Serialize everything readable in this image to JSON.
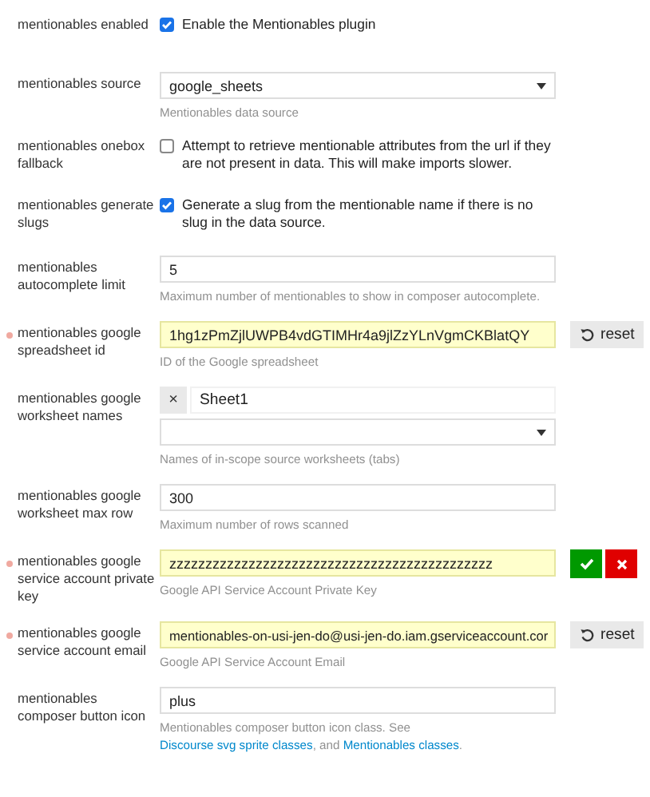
{
  "settings": [
    {
      "kind": "checkbox",
      "label": "mentionables enabled",
      "modified": false,
      "checked": true,
      "description": "Enable the Mentionables plugin"
    },
    {
      "kind": "select",
      "label": "mentionables source",
      "modified": false,
      "value": "google_sheets",
      "help": [
        {
          "kind": "text",
          "text": "Mentionables data source"
        }
      ]
    },
    {
      "kind": "checkbox",
      "label": "mentionables onebox fallback",
      "modified": false,
      "checked": false,
      "description": "Attempt to retrieve mentionable attributes from the url if they are not present in data. This will make imports slower."
    },
    {
      "kind": "checkbox",
      "label": "mentionables generate slugs",
      "modified": false,
      "checked": true,
      "description": "Generate a slug from the mentionable name if there is no slug in the data source."
    },
    {
      "kind": "text",
      "label": "mentionables autocomplete limit",
      "modified": false,
      "value": "5",
      "help": [
        {
          "kind": "text",
          "text": "Maximum number of mentionables to show in composer autocomplete."
        }
      ]
    },
    {
      "kind": "text",
      "label": "mentionables google spreadsheet id",
      "modified": true,
      "value": "1hg1zPmZjlUWPB4vdGTIMHr4a9jlZzYLnVgmCKBlatQY",
      "help": [
        {
          "kind": "text",
          "text": "ID of the Google spreadsheet"
        }
      ],
      "buttons": [
        {
          "kind": "reset",
          "label": "reset"
        }
      ]
    },
    {
      "kind": "list",
      "label": "mentionables google worksheet names",
      "modified": false,
      "tags": [
        {
          "remove": "×",
          "value": "Sheet1"
        }
      ],
      "help": [
        {
          "kind": "text",
          "text": "Names of in-scope source worksheets (tabs)"
        }
      ]
    },
    {
      "kind": "text",
      "label": "mentionables google worksheet max row",
      "modified": false,
      "value": "300",
      "help": [
        {
          "kind": "text",
          "text": "Maximum number of rows scanned"
        }
      ]
    },
    {
      "kind": "text",
      "label": "mentionables google service account private key",
      "modified": true,
      "value": "zzzzzzzzzzzzzzzzzzzzzzzzzzzzzzzzzzzzzzzzzzzzz",
      "help": [
        {
          "kind": "text",
          "text": "Google API Service Account Private Key"
        }
      ],
      "buttons": [
        {
          "kind": "ok"
        },
        {
          "kind": "cancel"
        }
      ]
    },
    {
      "kind": "text",
      "label": "mentionables google service account email",
      "modified": true,
      "value": "mentionables-on-usi-jen-do@usi-jen-do.iam.gserviceaccount.cor",
      "help": [
        {
          "kind": "text",
          "text": "Google API Service Account Email"
        }
      ],
      "buttons": [
        {
          "kind": "reset",
          "label": "reset"
        }
      ]
    },
    {
      "kind": "text",
      "label": "mentionables composer button icon",
      "modified": false,
      "value": "plus",
      "help": [
        {
          "kind": "text",
          "text": "Mentionables composer button icon class. See "
        },
        {
          "kind": "link",
          "text": "Discourse svg sprite classes"
        },
        {
          "kind": "text",
          "text": ", and "
        },
        {
          "kind": "link",
          "text": "Mentionables classes"
        },
        {
          "kind": "text",
          "text": "."
        }
      ]
    }
  ]
}
